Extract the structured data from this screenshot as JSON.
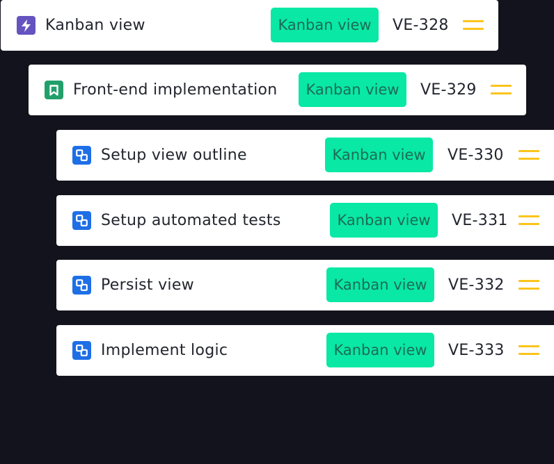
{
  "colors": {
    "background": "#12131c",
    "card": "#ffffff",
    "tag_bg": "#09e8a5",
    "tag_text": "#1c6c55",
    "handle": "#fbc41b",
    "epic_icon": "#6553c0",
    "story_icon": "#22a06b",
    "subtask_icon": "#1e6fe6"
  },
  "issues": [
    {
      "title": "Kanban view",
      "tag": "Kanban view",
      "key": "VE-328",
      "icon": "lightning-bolt-icon"
    },
    {
      "title": "Front-end implementation",
      "tag": "Kanban view",
      "key": "VE-329",
      "icon": "bookmark-icon"
    },
    {
      "title": "Setup view outline",
      "tag": "Kanban view",
      "key": "VE-330",
      "icon": "subtask-icon"
    },
    {
      "title": "Setup automated tests",
      "tag": "Kanban view",
      "key": "VE-331",
      "icon": "subtask-icon"
    },
    {
      "title": "Persist view",
      "tag": "Kanban view",
      "key": "VE-332",
      "icon": "subtask-icon"
    },
    {
      "title": "Implement logic",
      "tag": "Kanban view",
      "key": "VE-333",
      "icon": "subtask-icon"
    }
  ]
}
